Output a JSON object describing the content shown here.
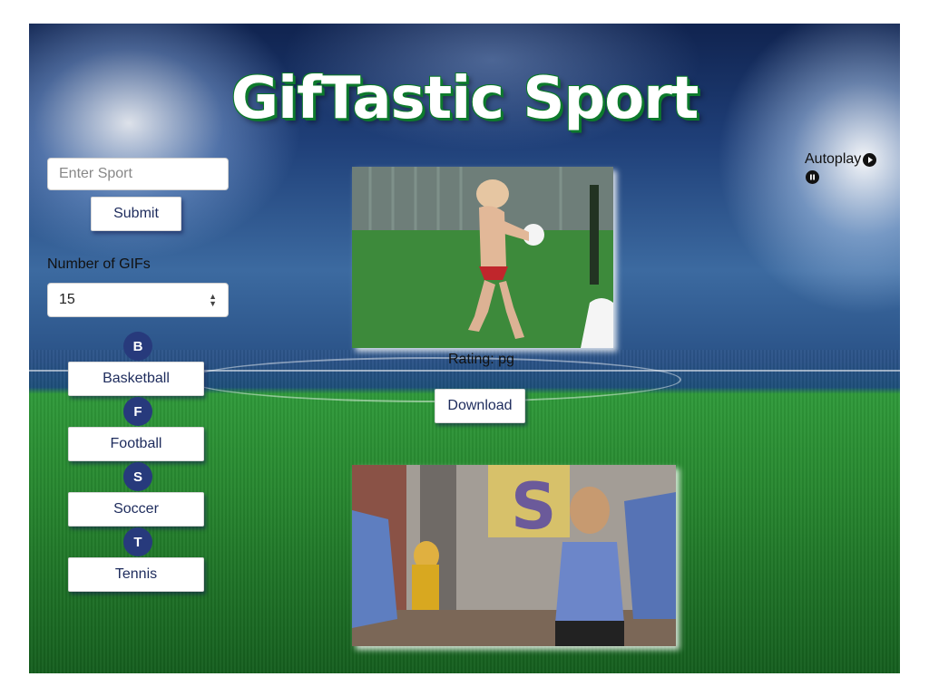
{
  "app": {
    "title": "GifTastic Sport"
  },
  "search": {
    "placeholder": "Enter Sport",
    "submit_label": "Submit"
  },
  "gif_count": {
    "label": "Number of GIFs",
    "value": "15"
  },
  "sports": [
    {
      "initial": "B",
      "label": "Basketball"
    },
    {
      "initial": "F",
      "label": "Football"
    },
    {
      "initial": "S",
      "label": "Soccer"
    },
    {
      "initial": "T",
      "label": "Tennis"
    }
  ],
  "controls": {
    "autoplay_label": "Autoplay",
    "play_icon": "play-icon",
    "pause_icon": "pause-icon"
  },
  "results": [
    {
      "rating_text": "Rating: pg",
      "download_label": "Download"
    }
  ],
  "colors": {
    "badge": "#273a7c",
    "title_outline": "#0d7a2c",
    "button_text": "#1d2b5c"
  }
}
